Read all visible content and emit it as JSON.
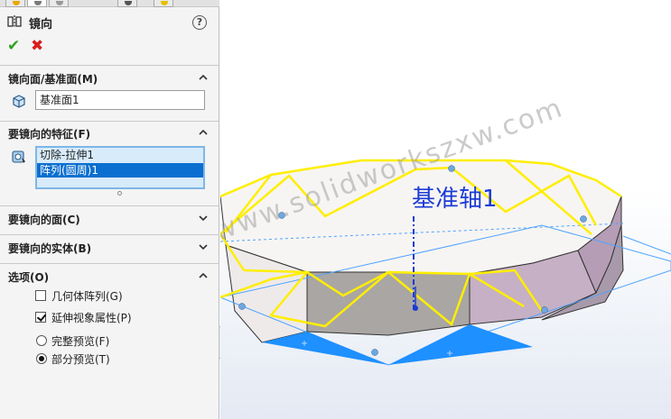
{
  "feature": {
    "title": "镜向",
    "help": "?"
  },
  "sections": {
    "mirror_plane": {
      "header": "镜向面/基准面(M)",
      "value": "基准面1"
    },
    "features_to_mirror": {
      "header": "要镜向的特征(F)",
      "items": [
        "切除-拉伸1",
        "阵列(圆周)1"
      ],
      "selected_index": 1
    },
    "faces_to_mirror": {
      "header": "要镜向的面(C)"
    },
    "bodies_to_mirror": {
      "header": "要镜向的实体(B)"
    },
    "options": {
      "header": "选项(O)",
      "geometry_pattern": {
        "label": "几何体阵列(G)",
        "checked": false
      },
      "propagate_visual": {
        "label": "延伸视象属性(P)",
        "checked": true
      },
      "full_preview": {
        "label": "完整预览(F)",
        "selected": false
      },
      "partial_preview": {
        "label": "部分预览(T)",
        "selected": true
      }
    }
  },
  "viewport": {
    "axis_label": "基准轴1",
    "watermark": "www.solidworkszxw.com"
  },
  "colors": {
    "accept": "#2ea31f",
    "cancel": "#d81e1e",
    "selection": "#0a6fd0",
    "preview_edges": "#ffee00",
    "axis": "#1c3bd6",
    "plane": "#1e90ff"
  }
}
